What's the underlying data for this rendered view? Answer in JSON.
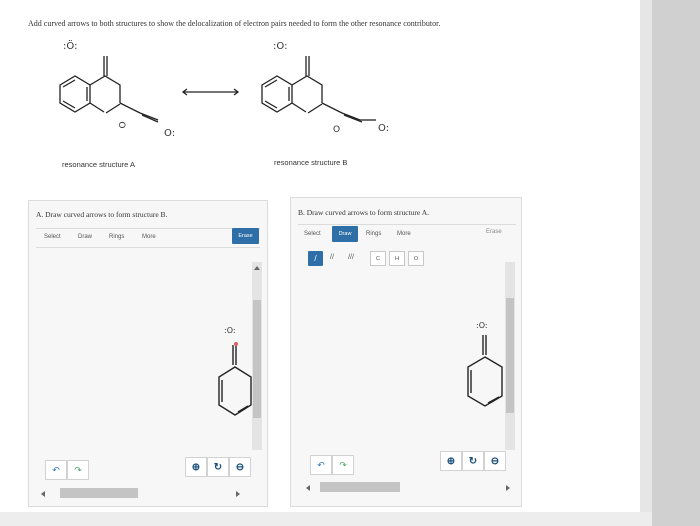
{
  "instructions": "Add curved arrows to both structures to show the delocalization of electron pairs needed to form the other resonance contributor.",
  "structure_a": {
    "caption": "resonance structure A",
    "top_o": ":Ö:",
    "ring_o": "O",
    "side_o": "O:"
  },
  "structure_b": {
    "caption": "resonance structure B",
    "top_o": ":O:",
    "ring_o": "O",
    "side_o": "O:"
  },
  "panel_a": {
    "title": "A. Draw curved arrows to form structure B.",
    "tabs": [
      "Select",
      "Draw",
      "Rings",
      "More"
    ],
    "erase_label": "Erase",
    "carbonyl_o": ":O:"
  },
  "panel_b": {
    "title": "B. Draw curved arrows to form structure A.",
    "tabs": [
      "Select",
      "Draw",
      "Rings",
      "More"
    ],
    "active_tab": "Draw",
    "erase_label": "Erase",
    "bond_tools": [
      "/",
      "//",
      "///"
    ],
    "atom_tools": [
      "C",
      "H",
      "O"
    ],
    "carbonyl_o": ":O:"
  },
  "colors": {
    "accent": "#2e6fa7",
    "zoom": "#1b4f7a",
    "undo": "#2d7bbf",
    "redo": "#4aa36a"
  }
}
